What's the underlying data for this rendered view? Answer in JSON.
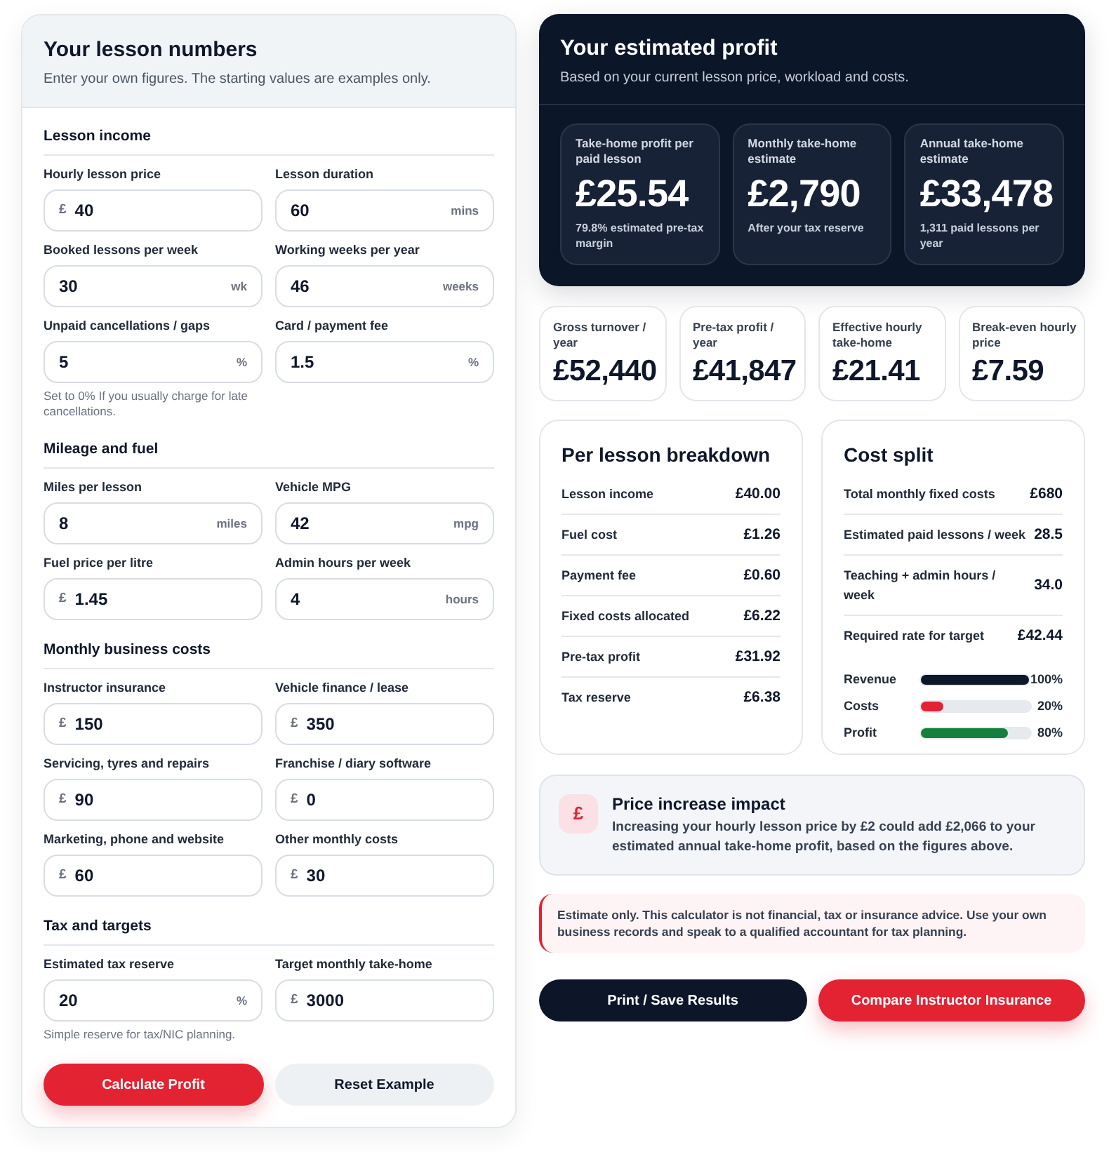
{
  "calculator": {
    "title": "Your lesson numbers",
    "subtitle": "Enter your own figures. The starting values are examples only.",
    "sections": [
      {
        "title": "Lesson income",
        "fields": [
          {
            "label": "Hourly lesson price",
            "prefix": "£",
            "value": "40"
          },
          {
            "label": "Lesson duration",
            "value": "60",
            "suffix": "mins"
          },
          {
            "label": "Booked lessons per week",
            "value": "30",
            "suffix": "wk"
          },
          {
            "label": "Working weeks per year",
            "value": "46",
            "suffix": "weeks"
          },
          {
            "label": "Unpaid cancellations / gaps",
            "value": "5",
            "suffix": "%",
            "hint": "Set to 0% If you usually charge for late cancellations."
          },
          {
            "label": "Card / payment fee",
            "value": "1.5",
            "suffix": "%"
          }
        ]
      },
      {
        "title": "Mileage and fuel",
        "fields": [
          {
            "label": "Miles per lesson",
            "value": "8",
            "suffix": "miles"
          },
          {
            "label": "Vehicle MPG",
            "value": "42",
            "suffix": "mpg"
          },
          {
            "label": "Fuel price per litre",
            "prefix": "£",
            "value": "1.45"
          },
          {
            "label": "Admin hours per week",
            "value": "4",
            "suffix": "hours"
          }
        ]
      },
      {
        "title": "Monthly business costs",
        "fields": [
          {
            "label": "Instructor insurance",
            "prefix": "£",
            "value": "150"
          },
          {
            "label": "Vehicle finance / lease",
            "prefix": "£",
            "value": "350"
          },
          {
            "label": "Servicing, tyres and repairs",
            "prefix": "£",
            "value": "90"
          },
          {
            "label": "Franchise / diary software",
            "prefix": "£",
            "value": "0"
          },
          {
            "label": "Marketing, phone and website",
            "prefix": "£",
            "value": "60"
          },
          {
            "label": "Other monthly costs",
            "prefix": "£",
            "value": "30"
          }
        ]
      },
      {
        "title": "Tax and targets",
        "fields": [
          {
            "label": "Estimated tax reserve",
            "value": "20",
            "suffix": "%",
            "hint": "Simple reserve for tax/NIC planning."
          },
          {
            "label": "Target monthly take-home",
            "prefix": "£",
            "value": "3000"
          }
        ]
      }
    ],
    "buttons": [
      {
        "label": "Calculate Profit",
        "kind": "primary"
      },
      {
        "label": "Reset Example",
        "kind": "secondary"
      }
    ]
  },
  "summary": {
    "title": "Your estimated profit",
    "subtitle": "Based on your current lesson price, workload and costs.",
    "metrics": [
      {
        "label": "Take-home profit per paid lesson",
        "value": "£25.54",
        "note": "79.8% estimated pre-tax margin"
      },
      {
        "label": "Monthly take-home estimate",
        "value": "£2,790",
        "note": "After your tax reserve"
      },
      {
        "label": "Annual take-home estimate",
        "value": "£33,478",
        "note": "1,311 paid lessons per year"
      }
    ]
  },
  "stats": [
    {
      "label": "Gross turnover / year",
      "value": "£52,440"
    },
    {
      "label": "Pre-tax profit / year",
      "value": "£41,847"
    },
    {
      "label": "Effective hourly take-home",
      "value": "£21.41"
    },
    {
      "label": "Break-even hourly price",
      "value": "£7.59"
    }
  ],
  "breakdown": {
    "title": "Per lesson breakdown",
    "rows": [
      {
        "label": "Lesson income",
        "value": "£40.00"
      },
      {
        "label": "Fuel cost",
        "value": "£1.26"
      },
      {
        "label": "Payment fee",
        "value": "£0.60"
      },
      {
        "label": "Fixed costs allocated",
        "value": "£6.22"
      },
      {
        "label": "Pre-tax profit",
        "value": "£31.92"
      },
      {
        "label": "Tax reserve",
        "value": "£6.38"
      }
    ]
  },
  "cost_split": {
    "title": "Cost split",
    "rows": [
      {
        "label": "Total monthly fixed costs",
        "value": "£680"
      },
      {
        "label": "Estimated paid lessons / week",
        "value": "28.5"
      },
      {
        "label": "Teaching + admin hours / week",
        "value": "34.0"
      },
      {
        "label": "Required rate for target",
        "value": "£42.44"
      }
    ],
    "bars": [
      {
        "label": "Revenue",
        "level": 1,
        "reading": "100%",
        "color": "#0f172a"
      },
      {
        "label": "Costs",
        "level": 0.2,
        "reading": "20%",
        "color": "#e32232"
      },
      {
        "label": "Profit",
        "level": 0.8,
        "reading": "80%",
        "color": "#15803d"
      }
    ]
  },
  "price_impact": {
    "icon": "£",
    "title": "Price increase impact",
    "text": "Increasing your hourly lesson price by £2 could add £2,066 to your estimated annual take-home profit, based on the figures above."
  },
  "disclaimer": "Estimate only. This calculator is not financial, tax or insurance advice. Use your own business records and speak to a qualified accountant for tax planning.",
  "actions": [
    {
      "label": "Print / Save Results",
      "kind": "dark"
    },
    {
      "label": "Compare Instructor Insurance",
      "kind": "primary"
    }
  ]
}
